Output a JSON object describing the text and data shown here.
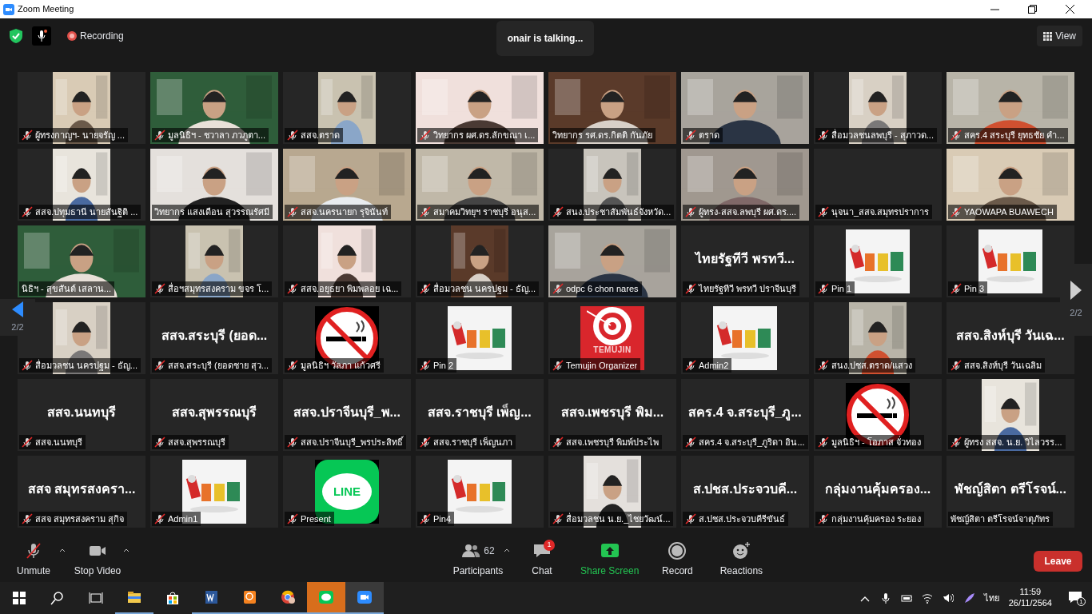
{
  "window": {
    "title": "Zoom Meeting"
  },
  "top_bar": {
    "recording": "Recording",
    "speaker_toast": "onair is talking...",
    "view": "View"
  },
  "pager": {
    "prev_page": "2/2",
    "next_page": "2/2"
  },
  "tiles": [
    {
      "kind": "portrait",
      "name": "ผู้ทรงกาญฯ- นายจรัญ ...",
      "muted": true
    },
    {
      "kind": "video",
      "name": "มูลนิธิฯ - ชวาลา ภวภูตา...",
      "muted": true
    },
    {
      "kind": "portrait",
      "name": "สสจ.ตราด",
      "muted": true
    },
    {
      "kind": "video",
      "name": "วิทยากร ผศ.ดร.ลักขณา เ...",
      "muted": true
    },
    {
      "kind": "video",
      "name": "วิทยากร รศ.ดร.กิตติ กันภัย",
      "muted": false
    },
    {
      "kind": "video",
      "name": "ตราด",
      "muted": true
    },
    {
      "kind": "portrait",
      "name": "สื่อมวลชนลพบุรี - สุภาวด...",
      "muted": true
    },
    {
      "kind": "video",
      "name": "สคร.4 สระบุรี ยุทธชัย คำ...",
      "muted": true
    },
    {
      "kind": "portrait",
      "name": "สสจ.ปทุมธานี นายสันฐิติ ...",
      "muted": true
    },
    {
      "kind": "video",
      "name": "วิทยากร แสงเดือน สุวรรณรัศมี",
      "muted": false
    },
    {
      "kind": "video",
      "name": "สสจ.นครนายก รุจินันท์",
      "muted": true
    },
    {
      "kind": "video",
      "name": "สมาคมวิทยุฯ ราชบุรี อนุส...",
      "muted": true
    },
    {
      "kind": "portrait",
      "name": "สนง.ประชาสัมพันธ์จังหวัด...",
      "muted": true
    },
    {
      "kind": "video",
      "name": "ผู้ทรง-สสจ.ลพบุรี ผศ.ดร....",
      "muted": true
    },
    {
      "kind": "blank",
      "name": "นุจนา_สสจ.สมุทรปราการ",
      "muted": true
    },
    {
      "kind": "video",
      "name": "YAOWAPA BUAWECH",
      "muted": true
    },
    {
      "kind": "video",
      "name": "นิธิฯ - สุขสันต์ เสลาน...",
      "muted": false
    },
    {
      "kind": "portrait",
      "name": "สื่อฯสมุทรสงคราม ขจร โ...",
      "muted": true
    },
    {
      "kind": "portrait",
      "name": "สสจ.อยุธยา พิมพลอย เฉ...",
      "muted": true
    },
    {
      "kind": "portrait",
      "name": "สื่อมวลชน นครปฐม - ธัญ...",
      "muted": true
    },
    {
      "kind": "video",
      "name": "odpc 6 chon nares",
      "muted": true
    },
    {
      "kind": "name",
      "display": "ไทยรัฐทีวี พรทวี...",
      "name": "ไทยรัฐทีวี พรทวี ปราจีนบุรี",
      "muted": true
    },
    {
      "kind": "team",
      "name": "Pin 1",
      "muted": true
    },
    {
      "kind": "team",
      "name": "Pin 3",
      "muted": true
    },
    {
      "kind": "portrait",
      "name": "สื่อมวลชน นครปฐม - ธัญ...",
      "muted": true
    },
    {
      "kind": "name",
      "display": "สสจ.สระบุรี (ยอด...",
      "name": "สสจ.สระบุรี (ยอดชาย สุว...",
      "muted": true
    },
    {
      "kind": "no-smoking",
      "name": "มูลนิธิฯ วัลภา แก้วศรี",
      "muted": true
    },
    {
      "kind": "team",
      "name": "Pin 2",
      "muted": true
    },
    {
      "kind": "temujin",
      "logo_text": "TEMUJIN",
      "name": "Temujin Organizer",
      "muted": true
    },
    {
      "kind": "team",
      "name": "Admin2",
      "muted": true
    },
    {
      "kind": "portrait",
      "name": "สนง.ปชส.ตราด/แสวง",
      "muted": true
    },
    {
      "kind": "name",
      "display": "สสจ.สิงห์บุรี วันเฉ...",
      "name": "สสจ.สิงห์บุรี วันเฉลิม",
      "muted": true
    },
    {
      "kind": "name",
      "display": "สสจ.นนทบุรี",
      "name": "สสจ.นนทบุรี",
      "muted": true
    },
    {
      "kind": "name",
      "display": "สสจ.สุพรรณบุรี",
      "name": "สสจ.สุพรรณบุรี",
      "muted": true
    },
    {
      "kind": "name",
      "display": "สสจ.ปราจีนบุรี_พ...",
      "name": "สสจ.ปราจีนบุรี_พรประสิทธิ์",
      "muted": true
    },
    {
      "kind": "name",
      "display": "สสจ.ราชบุรี เพ็ญ...",
      "name": "สสจ.ราชบุรี เพ็ญนภา",
      "muted": true
    },
    {
      "kind": "name",
      "display": "สสจ.เพชรบุรี พิม...",
      "name": "สสจ.เพชรบุรี พิมพ์ประไพ",
      "muted": true
    },
    {
      "kind": "name",
      "display": "สคร.4 จ.สระบุรี_ภู...",
      "name": "สคร.4 จ.สระบุรี_ภูริดา อิน...",
      "muted": true
    },
    {
      "kind": "no-smoking",
      "name": "มูลนิธิฯ - โอภาส จั่วทอง",
      "muted": true
    },
    {
      "kind": "portrait",
      "name": "ผู้ทรง สสจ. น.ย. วิไลวรร...",
      "muted": true
    },
    {
      "kind": "name",
      "display": "สสจ สมุทรสงครา...",
      "name": "สสจ สมุทรสงคราม สุกิจ",
      "muted": true
    },
    {
      "kind": "team",
      "name": "Admin1",
      "muted": true
    },
    {
      "kind": "line",
      "logo_text": "LINE",
      "name": "Present",
      "muted": true
    },
    {
      "kind": "team",
      "name": "Pin4",
      "muted": true
    },
    {
      "kind": "portrait",
      "name": "สื่อมวลชน น.ย._ไชยวัฒน์...",
      "muted": true
    },
    {
      "kind": "name",
      "display": "ส.ปชส.ประจวบคี...",
      "name": "ส.ปชส.ประจวบคีรีขันธ์",
      "muted": true
    },
    {
      "kind": "name",
      "display": "กลุ่มงานคุ้มครอง...",
      "name": "กลุ่มงานคุ้มครอง ระยอง",
      "muted": true
    },
    {
      "kind": "name",
      "display": "พัชญ์สิตา ตรีโรจน์...",
      "name": "พัชญ์สิตา ตรีโรจน์จาตุภัทร",
      "muted": false
    }
  ],
  "toolbar": [
    {
      "kind": "unmute",
      "label": "Unmute"
    },
    {
      "kind": "video",
      "label": "Stop Video"
    },
    {
      "kind": "participants",
      "label": "Participants",
      "count": "62"
    },
    {
      "kind": "chat",
      "label": "Chat",
      "badge": "1"
    },
    {
      "kind": "share",
      "label": "Share Screen"
    },
    {
      "kind": "record",
      "label": "Record"
    },
    {
      "kind": "reactions",
      "label": "Reactions"
    }
  ],
  "leave": "Leave",
  "taskbar": {
    "language": "ไทย",
    "time": "11:59",
    "date": "26/11/2564",
    "notifications": "1"
  }
}
